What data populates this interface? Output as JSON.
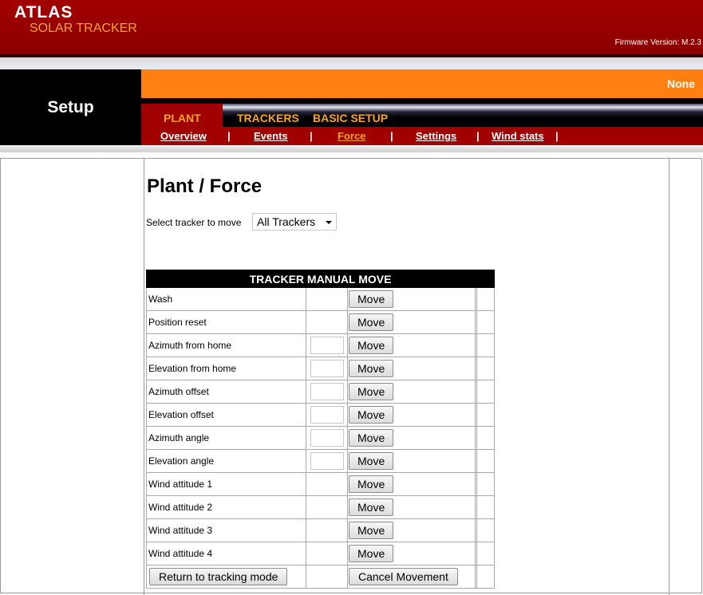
{
  "brand": {
    "name": "ATLAS",
    "subtitle": "SOLAR TRACKER",
    "firmware": "Firmware Version: M.2.3"
  },
  "header": {
    "section": "Setup",
    "status": "None"
  },
  "tabs": [
    {
      "label": "PLANT",
      "active": true
    },
    {
      "label": "TRACKERS",
      "active": false
    },
    {
      "label": "BASIC SETUP",
      "active": false
    }
  ],
  "subnav": [
    {
      "label": "Overview",
      "active": false
    },
    {
      "label": "Events",
      "active": false
    },
    {
      "label": "Force",
      "active": true
    },
    {
      "label": "Settings",
      "active": false
    },
    {
      "label": "Wind stats",
      "active": false
    }
  ],
  "subnav_separator": "|",
  "page": {
    "title": "Plant / Force",
    "select_label": "Select tracker to move",
    "select_value": "All Trackers"
  },
  "table": {
    "header": "TRACKER MANUAL MOVE",
    "move_label": "Move",
    "rows": [
      {
        "label": "Wash",
        "has_input": false
      },
      {
        "label": "Position reset",
        "has_input": false
      },
      {
        "label": "Azimuth from home",
        "has_input": true
      },
      {
        "label": "Elevation from home",
        "has_input": true
      },
      {
        "label": "Azimuth offset",
        "has_input": true
      },
      {
        "label": "Elevation offset",
        "has_input": true
      },
      {
        "label": "Azimuth angle",
        "has_input": true
      },
      {
        "label": "Elevation angle",
        "has_input": true
      },
      {
        "label": "Wind attitude 1",
        "has_input": false
      },
      {
        "label": "Wind attitude 2",
        "has_input": false
      },
      {
        "label": "Wind attitude 3",
        "has_input": false
      },
      {
        "label": "Wind attitude 4",
        "has_input": false
      }
    ],
    "return_button": "Return to tracking mode",
    "cancel_button": "Cancel Movement"
  },
  "colors": {
    "banner": "#a30000",
    "accent": "#ff8010",
    "tab_text": "#f6a623"
  }
}
